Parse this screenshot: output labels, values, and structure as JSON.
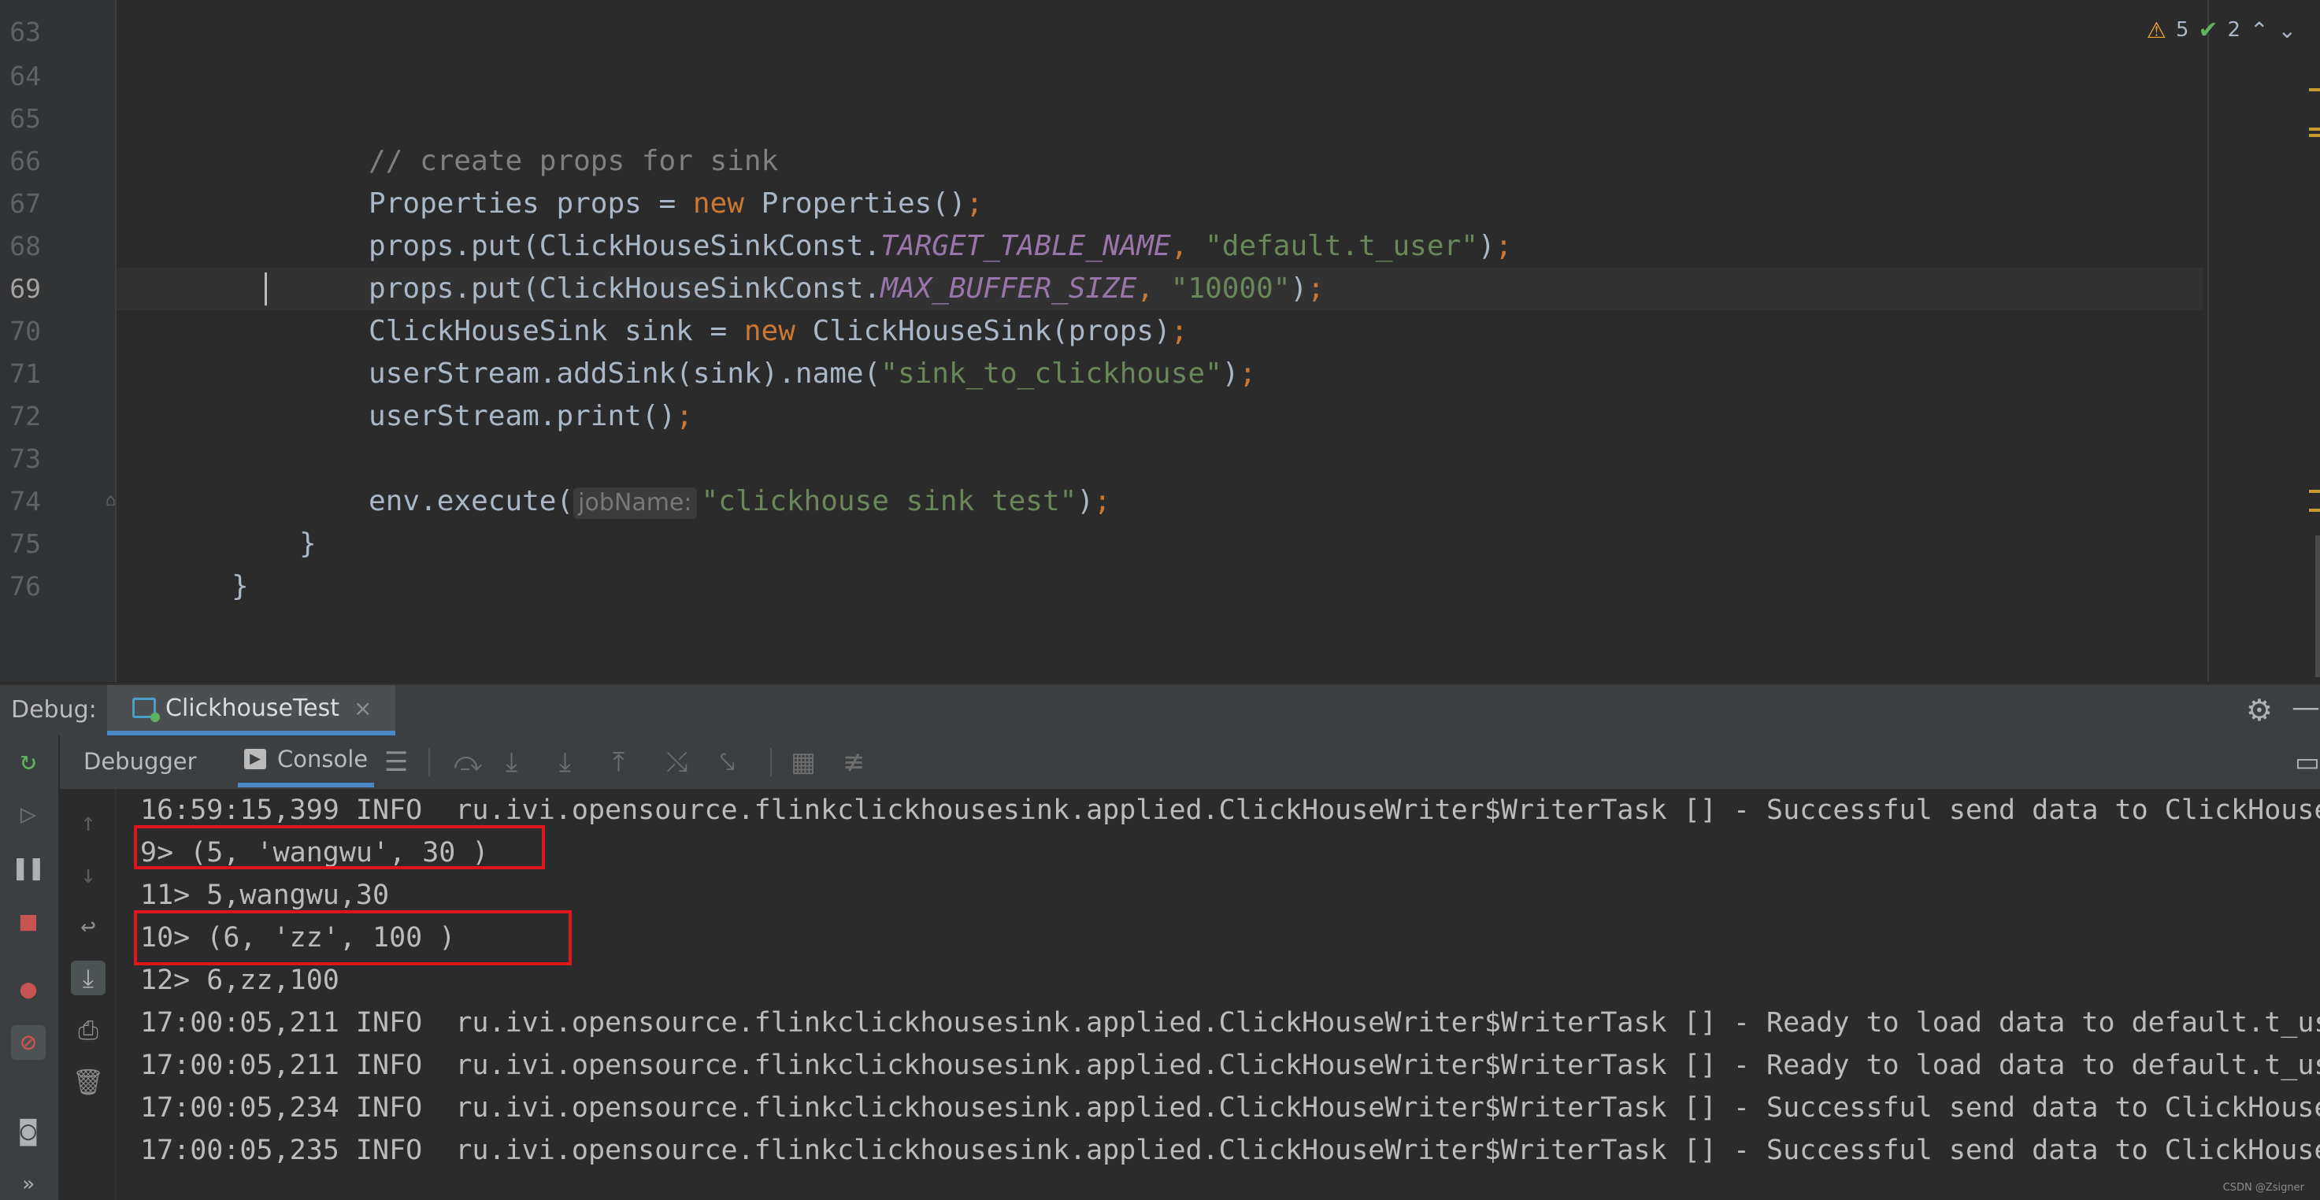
{
  "editor": {
    "line_numbers": [
      "63",
      "64",
      "65",
      "66",
      "67",
      "68",
      "69",
      "70",
      "71",
      "72",
      "73",
      "74",
      "75",
      "76"
    ],
    "active_line": "69",
    "lines": {
      "l65": {
        "comment": "// create props for sink"
      },
      "l66": {
        "a": "Properties props = ",
        "kw": "new",
        "b": " Properties()",
        "semi": ";"
      },
      "l67": {
        "a": "props.put(ClickHouseSinkConst.",
        "const": "TARGET_TABLE_NAME",
        "comma": ", ",
        "str": "\"default.t_user\"",
        "b": ")",
        "semi": ";"
      },
      "l68": {
        "a": "props.put(ClickHouseSinkConst.",
        "const": "MAX_BUFFER_SIZE",
        "comma": ", ",
        "str": "\"10000\"",
        "b": ")",
        "semi": ";"
      },
      "l69": {
        "a": "ClickHouseSink sink = ",
        "kw": "new",
        "b": " ClickHouseSink(props)",
        "semi": ";"
      },
      "l70": {
        "a": "userStream.addSink(sink).name(",
        "str": "\"sink_to_clickhouse\"",
        "b": ")",
        "semi": ";"
      },
      "l71": {
        "a": "userStream.print()",
        "semi": ";"
      },
      "l73": {
        "a": "env.execute(",
        "hint": "jobName:",
        "str": "\"clickhouse sink test\"",
        "b": ")",
        "semi": ";"
      },
      "l74": {
        "a": "}"
      },
      "l75": {
        "a": "}"
      }
    },
    "inspection": {
      "warnings": "5",
      "checks": "2",
      "warning_icon": "warning-triangle-icon",
      "check_icon": "double-check-icon"
    }
  },
  "debug": {
    "label": "Debug:",
    "tab_label": "ClickhouseTest",
    "tab_close": "×",
    "subtabs": {
      "debugger": "Debugger",
      "console": "Console"
    }
  },
  "console": {
    "lines": [
      "16:59:15,399 INFO  ru.ivi.opensource.flinkclickhousesink.applied.ClickHouseWriter$WriterTask [] - Successful send data to ClickHouse",
      "9> (5, 'wangwu', 30 )",
      "11> 5,wangwu,30",
      "10> (6, 'zz', 100 )",
      "12> 6,zz,100",
      "17:00:05,211 INFO  ru.ivi.opensource.flinkclickhousesink.applied.ClickHouseWriter$WriterTask [] - Ready to load data to default.t_user",
      "17:00:05,211 INFO  ru.ivi.opensource.flinkclickhousesink.applied.ClickHouseWriter$WriterTask [] - Ready to load data to default.t_user",
      "17:00:05,234 INFO  ru.ivi.opensource.flinkclickhousesink.applied.ClickHouseWriter$WriterTask [] - Successful send data to ClickHouse",
      "17:00:05,235 INFO  ru.ivi.opensource.flinkclickhousesink.applied.ClickHouseWriter$WriterTask [] - Successful send data to ClickHouse"
    ]
  },
  "watermark": "CSDN @Zsigner",
  "colors": {
    "highlight_box": "#e0141e",
    "accent_tab": "#4a88c7"
  }
}
